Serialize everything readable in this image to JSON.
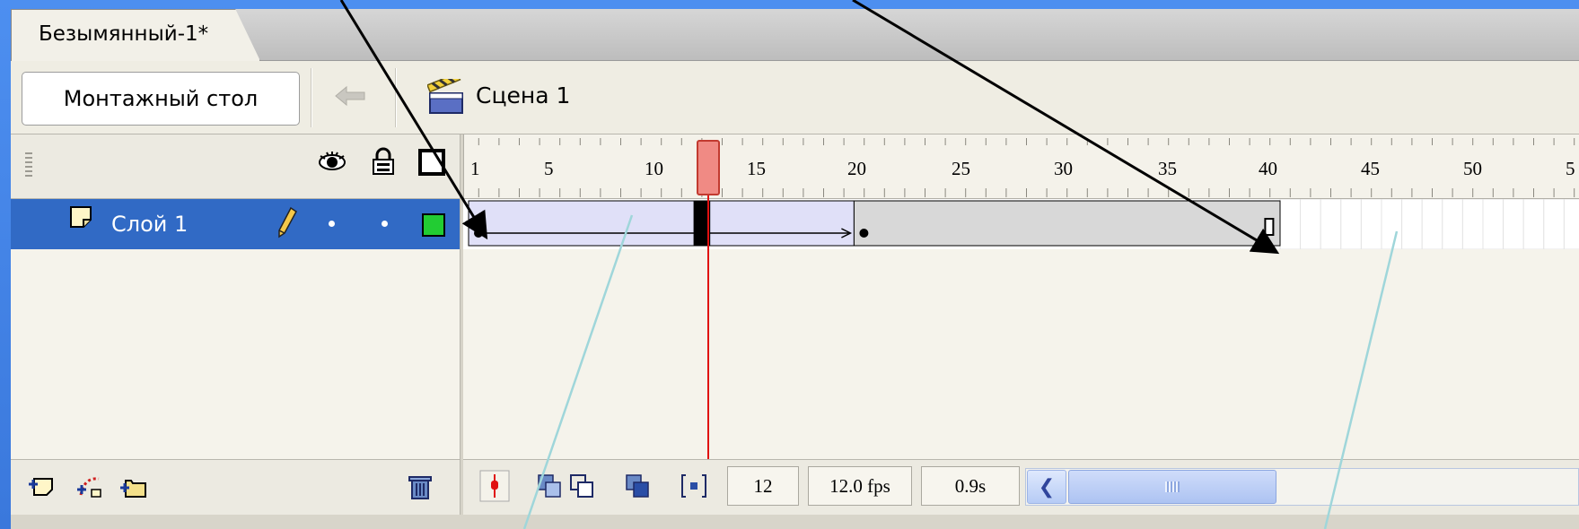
{
  "document": {
    "tab_title": "Безымянный-1*"
  },
  "toolbar": {
    "stage_button_label": "Монтажный стол",
    "back_icon": "back-arrow-icon",
    "scene_icon": "clapperboard-icon",
    "scene_label": "Сцена 1"
  },
  "layers_header": {
    "icons": [
      "eye-icon",
      "lock-icon",
      "outline-square-icon"
    ]
  },
  "ruler": {
    "labels": [
      "1",
      "5",
      "10",
      "15",
      "20",
      "25",
      "30",
      "35",
      "40",
      "45",
      "50",
      "5"
    ]
  },
  "layers": [
    {
      "name": "Слой 1",
      "selected": true,
      "color": "#22cc33"
    }
  ],
  "timeline": {
    "current_frame_value": 12,
    "tween_start_frame": 1,
    "tween_end_frame": 20,
    "last_frame": 40
  },
  "status": {
    "current_frame": "12",
    "frame_rate": "12.0 fps",
    "elapsed_time": "0.9s"
  },
  "colors": {
    "selection": "#316ac5",
    "playhead": "#e01010",
    "layer_color": "#22cc33"
  }
}
